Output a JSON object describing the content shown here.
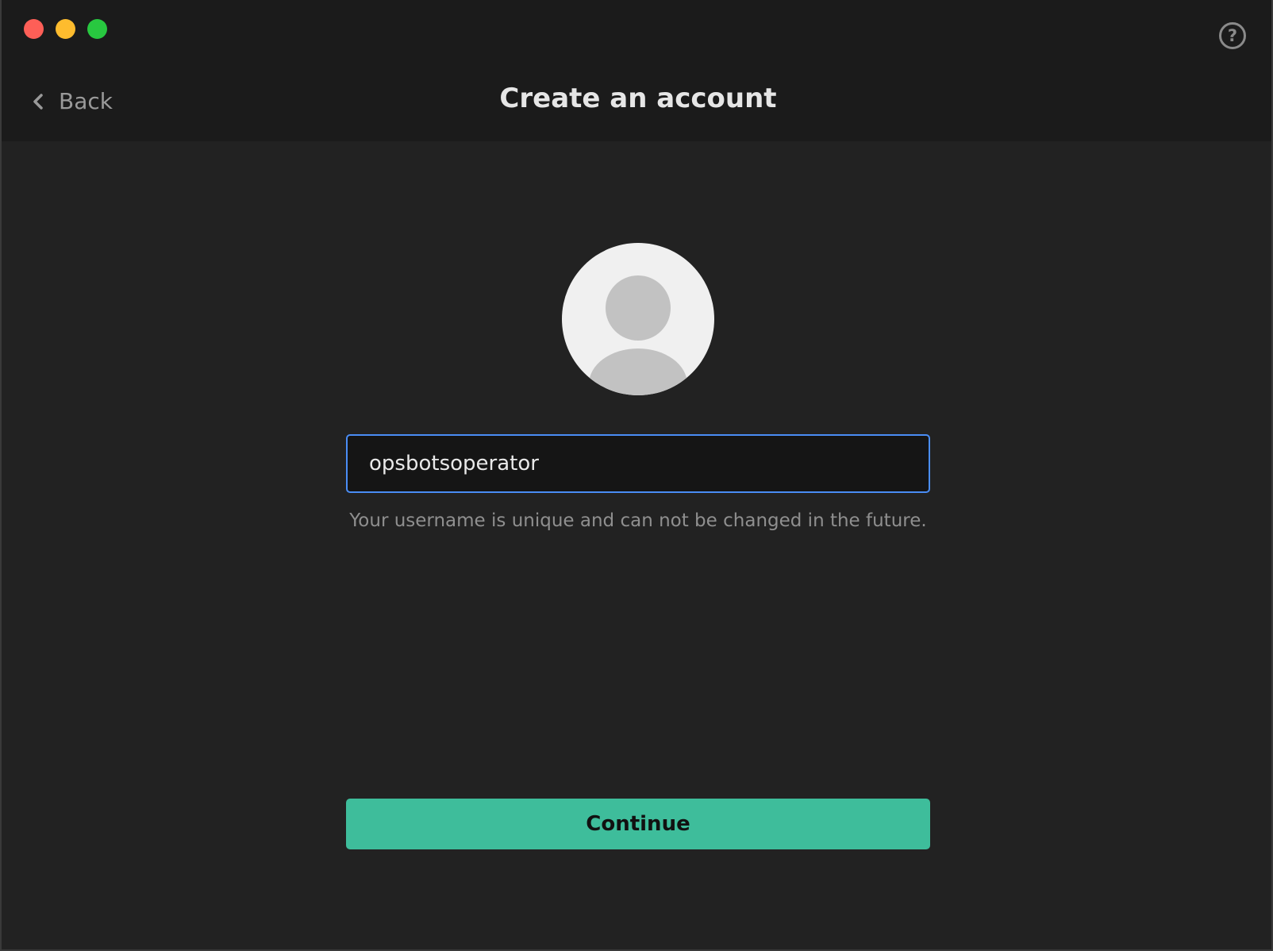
{
  "window": {
    "controls": [
      {
        "name": "close",
        "color": "#fe5f57"
      },
      {
        "name": "minimize",
        "color": "#febc2e"
      },
      {
        "name": "maximize",
        "color": "#28c840"
      }
    ]
  },
  "header": {
    "back_label": "Back",
    "back_icon": "chevron-left-icon",
    "title": "Create an account",
    "help_icon": "question-circle-icon",
    "help_glyph": "?"
  },
  "main": {
    "avatar_icon": "user-placeholder-icon",
    "username": {
      "value": "opsbotsoperator",
      "placeholder": ""
    },
    "helper_text": "Your username is unique and can not be changed in the future.",
    "continue_label": "Continue"
  },
  "colors": {
    "accent": "#3ebd9b",
    "focus_ring": "#4a8df5",
    "background": "#222222",
    "titlebar": "#1b1b1b"
  }
}
